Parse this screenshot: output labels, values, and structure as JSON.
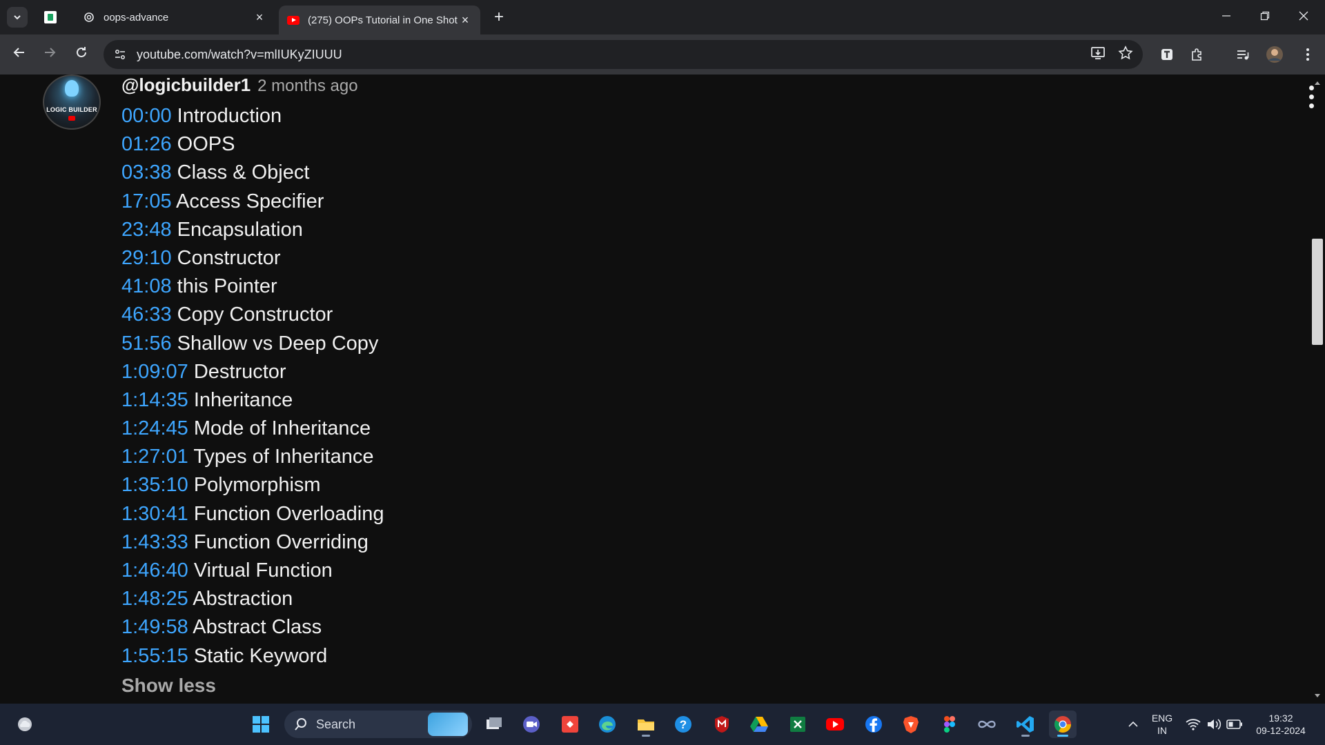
{
  "browser": {
    "tabs": [
      {
        "title": "oops-advance",
        "icon": "openai-icon",
        "active": false
      },
      {
        "title": "(275) OOPs Tutorial in One Shot",
        "icon": "youtube-icon",
        "active": true
      }
    ],
    "url": "youtube.com/watch?v=mlIUKyZIUUU"
  },
  "comment": {
    "author": "@logicbuilder1",
    "time": "2 months ago",
    "avatar_text": "LOGIC BUILDER",
    "chapters": [
      {
        "ts": "00:00",
        "label": "Introduction"
      },
      {
        "ts": "01:26",
        "label": "OOPS"
      },
      {
        "ts": "03:38",
        "label": "Class & Object"
      },
      {
        "ts": "17:05",
        "label": "Access Specifier"
      },
      {
        "ts": "23:48",
        "label": "Encapsulation"
      },
      {
        "ts": "29:10",
        "label": "Constructor"
      },
      {
        "ts": "41:08",
        "label": "this Pointer"
      },
      {
        "ts": "46:33",
        "label": "Copy Constructor"
      },
      {
        "ts": "51:56",
        "label": "Shallow vs Deep Copy"
      },
      {
        "ts": "1:09:07",
        "label": "Destructor"
      },
      {
        "ts": "1:14:35",
        "label": "Inheritance"
      },
      {
        "ts": "1:24:45",
        "label": "Mode of Inheritance"
      },
      {
        "ts": "1:27:01",
        "label": "Types of Inheritance"
      },
      {
        "ts": "1:35:10",
        "label": "Polymorphism"
      },
      {
        "ts": "1:30:41",
        "label": "Function Overloading"
      },
      {
        "ts": "1:43:33",
        "label": "Function Overriding"
      },
      {
        "ts": "1:46:40",
        "label": "Virtual Function"
      },
      {
        "ts": "1:48:25",
        "label": "Abstraction"
      },
      {
        "ts": "1:49:58",
        "label": "Abstract Class"
      },
      {
        "ts": "1:55:15",
        "label": "Static Keyword"
      }
    ],
    "show_less": "Show less"
  },
  "taskbar": {
    "search_label": "Search",
    "lang_top": "ENG",
    "lang_bottom": "IN",
    "time": "19:32",
    "date": "09-12-2024"
  },
  "colors": {
    "timestamp": "#3ea6ff",
    "background": "#0f0f0f",
    "text": "#f1f1f1",
    "muted": "#aaaaaa"
  }
}
